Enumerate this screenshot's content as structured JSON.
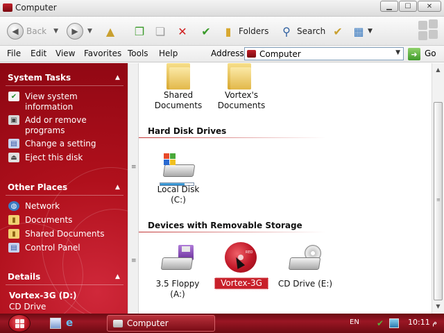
{
  "window": {
    "title": "Computer"
  },
  "toolbar": {
    "back_label": "Back",
    "folders_label": "Folders",
    "search_label": "Search"
  },
  "menu": [
    "File",
    "Edit",
    "View",
    "Favorites",
    "Tools",
    "Help"
  ],
  "address": {
    "label": "Address",
    "value": "Computer",
    "go_label": "Go"
  },
  "taskpane": {
    "system_tasks": {
      "title": "System Tasks",
      "items": [
        "View system information",
        "Add or remove programs",
        "Change a setting",
        "Eject this disk"
      ]
    },
    "other_places": {
      "title": "Other Places",
      "items": [
        "Network",
        "Documents",
        "Shared Documents",
        "Control Panel"
      ]
    },
    "details": {
      "title": "Details",
      "name": "Vortex-3G (D:)",
      "type": "CD Drive"
    }
  },
  "content": {
    "folders": [
      {
        "name": "Shared Documents",
        "line1": "Shared",
        "line2": "Documents"
      },
      {
        "name": "Vortex's Documents",
        "line1": "Vortex's",
        "line2": "Documents"
      }
    ],
    "hard_disk_group": "Hard Disk Drives",
    "hard_disks": [
      {
        "label": "Local Disk (C:)",
        "used_fraction": 0.72
      }
    ],
    "removable_group": "Devices with Removable Storage",
    "removable": [
      {
        "label": "3.5 Floppy (A:)"
      },
      {
        "label": "Vortex-3G (D:)",
        "selected": true,
        "icon_text": "RED"
      },
      {
        "label": "CD Drive (E:)"
      }
    ]
  },
  "taskbar": {
    "window_button": "Computer",
    "language": "EN",
    "clock": "10:11 م"
  },
  "colors": {
    "accent": "#b0101c",
    "selection": "#c8202a",
    "taskbar": "#8a1220"
  }
}
